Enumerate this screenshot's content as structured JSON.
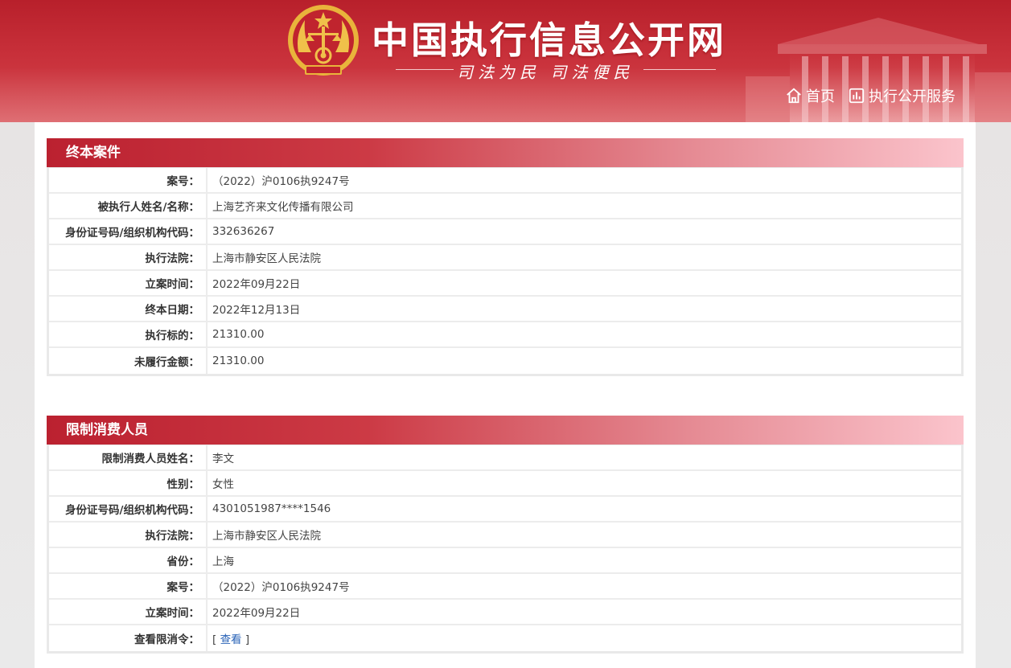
{
  "header": {
    "site_title": "中国执行信息公开网",
    "slogan": "司法为民  司法便民",
    "nav": [
      {
        "label": "首页",
        "icon": "home-icon"
      },
      {
        "label": "执行公开服务",
        "icon": "chart-icon"
      }
    ],
    "colors": {
      "brand_red": "#c7323b",
      "gold": "#e9b43b"
    }
  },
  "section1": {
    "title": "终本案件",
    "rows": [
      {
        "label": "案号：",
        "value": "（2022）沪0106执9247号"
      },
      {
        "label": "被执行人姓名/名称：",
        "value": "上海艺齐来文化传播有限公司"
      },
      {
        "label": "身份证号码/组织机构代码：",
        "value": "332636267"
      },
      {
        "label": "执行法院：",
        "value": "上海市静安区人民法院"
      },
      {
        "label": "立案时间：",
        "value": "2022年09月22日"
      },
      {
        "label": "终本日期：",
        "value": "2022年12月13日"
      },
      {
        "label": "执行标的：",
        "value": "21310.00"
      },
      {
        "label": "未履行金额：",
        "value": "21310.00"
      }
    ]
  },
  "section2": {
    "title": "限制消费人员",
    "rows": [
      {
        "label": "限制消费人员姓名：",
        "value": "李文"
      },
      {
        "label": "性别：",
        "value": "女性"
      },
      {
        "label": "身份证号码/组织机构代码：",
        "value": "4301051987****1546"
      },
      {
        "label": "执行法院：",
        "value": "上海市静安区人民法院"
      },
      {
        "label": "省份：",
        "value": "上海"
      },
      {
        "label": "案号：",
        "value": "（2022）沪0106执9247号"
      },
      {
        "label": "立案时间：",
        "value": "2022年09月22日"
      },
      {
        "label": "查看限消令：",
        "value_prefix": "[ ",
        "link": "查看",
        "value_suffix": " ]"
      }
    ]
  }
}
